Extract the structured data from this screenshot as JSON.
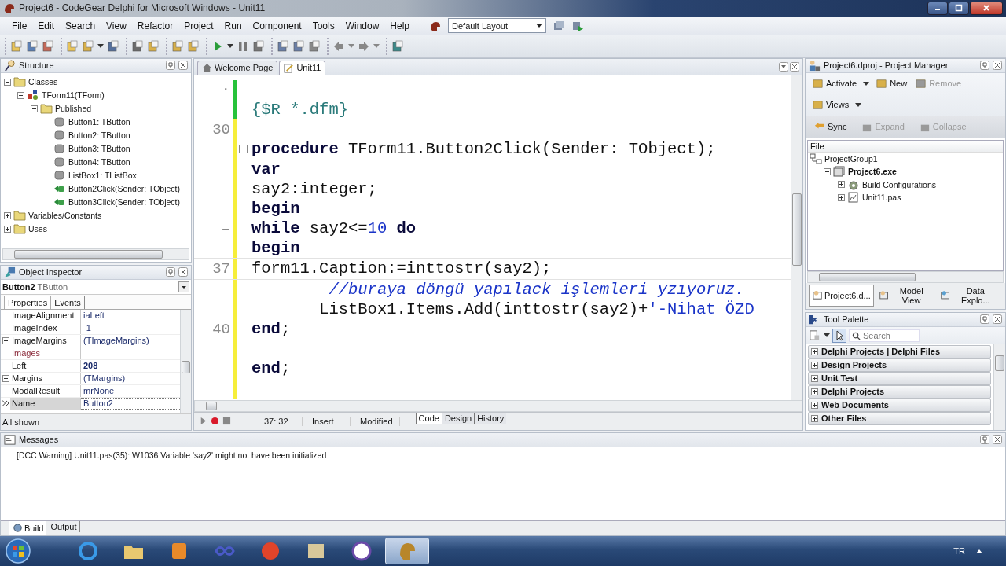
{
  "window": {
    "title": "Project6 - CodeGear Delphi for Microsoft Windows - Unit11"
  },
  "menu": [
    "File",
    "Edit",
    "Search",
    "View",
    "Refactor",
    "Project",
    "Run",
    "Component",
    "Tools",
    "Window",
    "Help"
  ],
  "layout_select": {
    "value": "Default Layout"
  },
  "structure": {
    "title": "Structure",
    "tree": [
      {
        "label": "Classes",
        "kind": "folder",
        "expanded": true,
        "children": [
          {
            "label": "TForm11(TForm)",
            "kind": "class",
            "expanded": true,
            "children": [
              {
                "label": "Published",
                "kind": "folder",
                "expanded": true,
                "children": [
                  {
                    "label": "Button1: TButton",
                    "kind": "field"
                  },
                  {
                    "label": "Button2: TButton",
                    "kind": "field"
                  },
                  {
                    "label": "Button3: TButton",
                    "kind": "field"
                  },
                  {
                    "label": "Button4: TButton",
                    "kind": "field"
                  },
                  {
                    "label": "ListBox1: TListBox",
                    "kind": "field"
                  },
                  {
                    "label": "Button2Click(Sender: TObject)",
                    "kind": "method"
                  },
                  {
                    "label": "Button3Click(Sender: TObject)",
                    "kind": "method"
                  }
                ]
              }
            ]
          }
        ]
      },
      {
        "label": "Variables/Constants",
        "kind": "folder",
        "expanded": false
      },
      {
        "label": "Uses",
        "kind": "folder",
        "expanded": false
      }
    ]
  },
  "object_inspector": {
    "title": "Object Inspector",
    "object_name": "Button2",
    "object_type": "TButton",
    "tabs": [
      {
        "label": "Properties",
        "selected": true
      },
      {
        "label": "Events",
        "selected": false
      }
    ],
    "properties": [
      {
        "name": "ImageAlignment",
        "value": "iaLeft",
        "kind": "plain",
        "modified": false,
        "selected": false
      },
      {
        "name": "ImageIndex",
        "value": "-1",
        "kind": "plain",
        "modified": false,
        "selected": false
      },
      {
        "name": "ImageMargins",
        "value": "(TImageMargins)",
        "kind": "plain",
        "expandable": true,
        "modified": false,
        "selected": false
      },
      {
        "name": "Images",
        "kind": "reference",
        "selected": false
      },
      {
        "name": "Left",
        "value": "208",
        "kind": "plain",
        "modified": true,
        "selected": false
      },
      {
        "name": "Margins",
        "value": "(TMargins)",
        "kind": "plain",
        "expandable": true,
        "modified": false,
        "selected": false
      },
      {
        "name": "ModalResult",
        "value": "mrNone",
        "kind": "plain",
        "modified": false,
        "selected": false
      },
      {
        "name": "Name",
        "value": "Button2",
        "kind": "plain",
        "modified": false,
        "selected": true
      }
    ],
    "status": "All shown"
  },
  "editor": {
    "tabs": [
      {
        "label": "Welcome Page",
        "selected": false
      },
      {
        "label": "Unit11",
        "selected": true
      }
    ],
    "lines": [
      {
        "gutter": "·",
        "saved": true
      },
      {
        "tokens": [
          {
            "kind": "directive",
            "text": "{$R *.dfm}"
          }
        ],
        "saved": true
      },
      {
        "gutter": "30",
        "saved": false
      },
      {
        "tokens": [
          {
            "kind": "keyword",
            "text": "procedure"
          },
          {
            "kind": "plain",
            "text": " TForm11.Button2Click(Sender: TObject);"
          }
        ],
        "saved": false,
        "fold": true
      },
      {
        "tokens": [
          {
            "kind": "keyword",
            "text": "var"
          }
        ],
        "saved": false
      },
      {
        "tokens": [
          {
            "kind": "plain",
            "text": "say2:integer;"
          }
        ],
        "saved": false
      },
      {
        "tokens": [
          {
            "kind": "keyword",
            "text": "begin"
          }
        ],
        "saved": false
      },
      {
        "gutter": "–",
        "tokens": [
          {
            "kind": "keyword",
            "text": "while"
          },
          {
            "kind": "plain",
            "text": " say2<="
          },
          {
            "kind": "number",
            "text": "10"
          },
          {
            "kind": "keyword",
            "text": " do"
          }
        ],
        "saved": false
      },
      {
        "tokens": [
          {
            "kind": "keyword",
            "text": "begin"
          }
        ],
        "saved": false
      },
      {
        "gutter": "37",
        "tokens": [
          {
            "kind": "plain",
            "text": "form11.Caption:=inttostr(say2);"
          }
        ],
        "saved": false,
        "current": true
      },
      {
        "tokens": [
          {
            "kind": "comment",
            "text": "        //buraya döngü yapılack işlemleri yzıyoruz."
          }
        ],
        "saved": false
      },
      {
        "tokens": [
          {
            "kind": "plain",
            "text": "       ListBox1.Items.Add(inttostr(say2)+"
          },
          {
            "kind": "string",
            "text": "'-Nihat ÖZD"
          }
        ],
        "saved": false
      },
      {
        "gutter": "40",
        "tokens": [
          {
            "kind": "keyword",
            "text": "end"
          },
          {
            "kind": "plain",
            "text": ";"
          }
        ],
        "saved": false
      },
      {
        "saved": false
      },
      {
        "tokens": [
          {
            "kind": "keyword",
            "text": "end"
          },
          {
            "kind": "plain",
            "text": ";"
          }
        ],
        "saved": false
      },
      {
        "saved": false
      }
    ],
    "status": {
      "position": "37: 32",
      "mode": "Insert",
      "state": "Modified"
    },
    "view_tabs": [
      {
        "label": "Code",
        "selected": true
      },
      {
        "label": "Design",
        "selected": false
      },
      {
        "label": "History",
        "selected": false
      }
    ]
  },
  "project_manager": {
    "title": "Project6.dproj - Project Manager",
    "buttons": [
      {
        "label": "Activate",
        "disabled": false
      },
      {
        "label": "New",
        "disabled": false
      },
      {
        "label": "Remove",
        "disabled": true
      },
      {
        "label": "Views",
        "disabled": false
      }
    ],
    "tree_buttons": [
      {
        "label": "Sync",
        "disabled": false
      },
      {
        "label": "Expand",
        "disabled": true
      },
      {
        "label": "Collapse",
        "disabled": true
      }
    ],
    "column": "File",
    "tree": [
      {
        "label": "ProjectGroup1",
        "kind": "group",
        "bold": false,
        "children": [
          {
            "label": "Project6.exe",
            "kind": "project",
            "bold": true,
            "expanded": true,
            "children": [
              {
                "label": "Build Configurations",
                "kind": "config",
                "bold": false,
                "expanded": false
              },
              {
                "label": "Unit11.pas",
                "kind": "unit",
                "bold": false,
                "expanded": false
              }
            ]
          }
        ]
      }
    ],
    "tabs": [
      {
        "label": "Project6.d...",
        "selected": true
      },
      {
        "label": "Model View",
        "selected": false
      },
      {
        "label": "Data Explo...",
        "selected": false
      }
    ]
  },
  "tool_palette": {
    "title": "Tool Palette",
    "search": {
      "placeholder": "Search"
    },
    "categories": [
      "Delphi Projects | Delphi Files",
      "Design Projects",
      "Unit Test",
      "Delphi Projects",
      "Web Documents",
      "Other Files"
    ]
  },
  "messages": {
    "title": "Messages",
    "items": [
      "[DCC Warning] Unit11.pas(35): W1036 Variable 'say2' might not have been initialized"
    ],
    "tabs": [
      {
        "label": "Build",
        "selected": true
      },
      {
        "label": "Output",
        "selected": false
      }
    ]
  },
  "taskbar": {
    "language": "TR"
  }
}
